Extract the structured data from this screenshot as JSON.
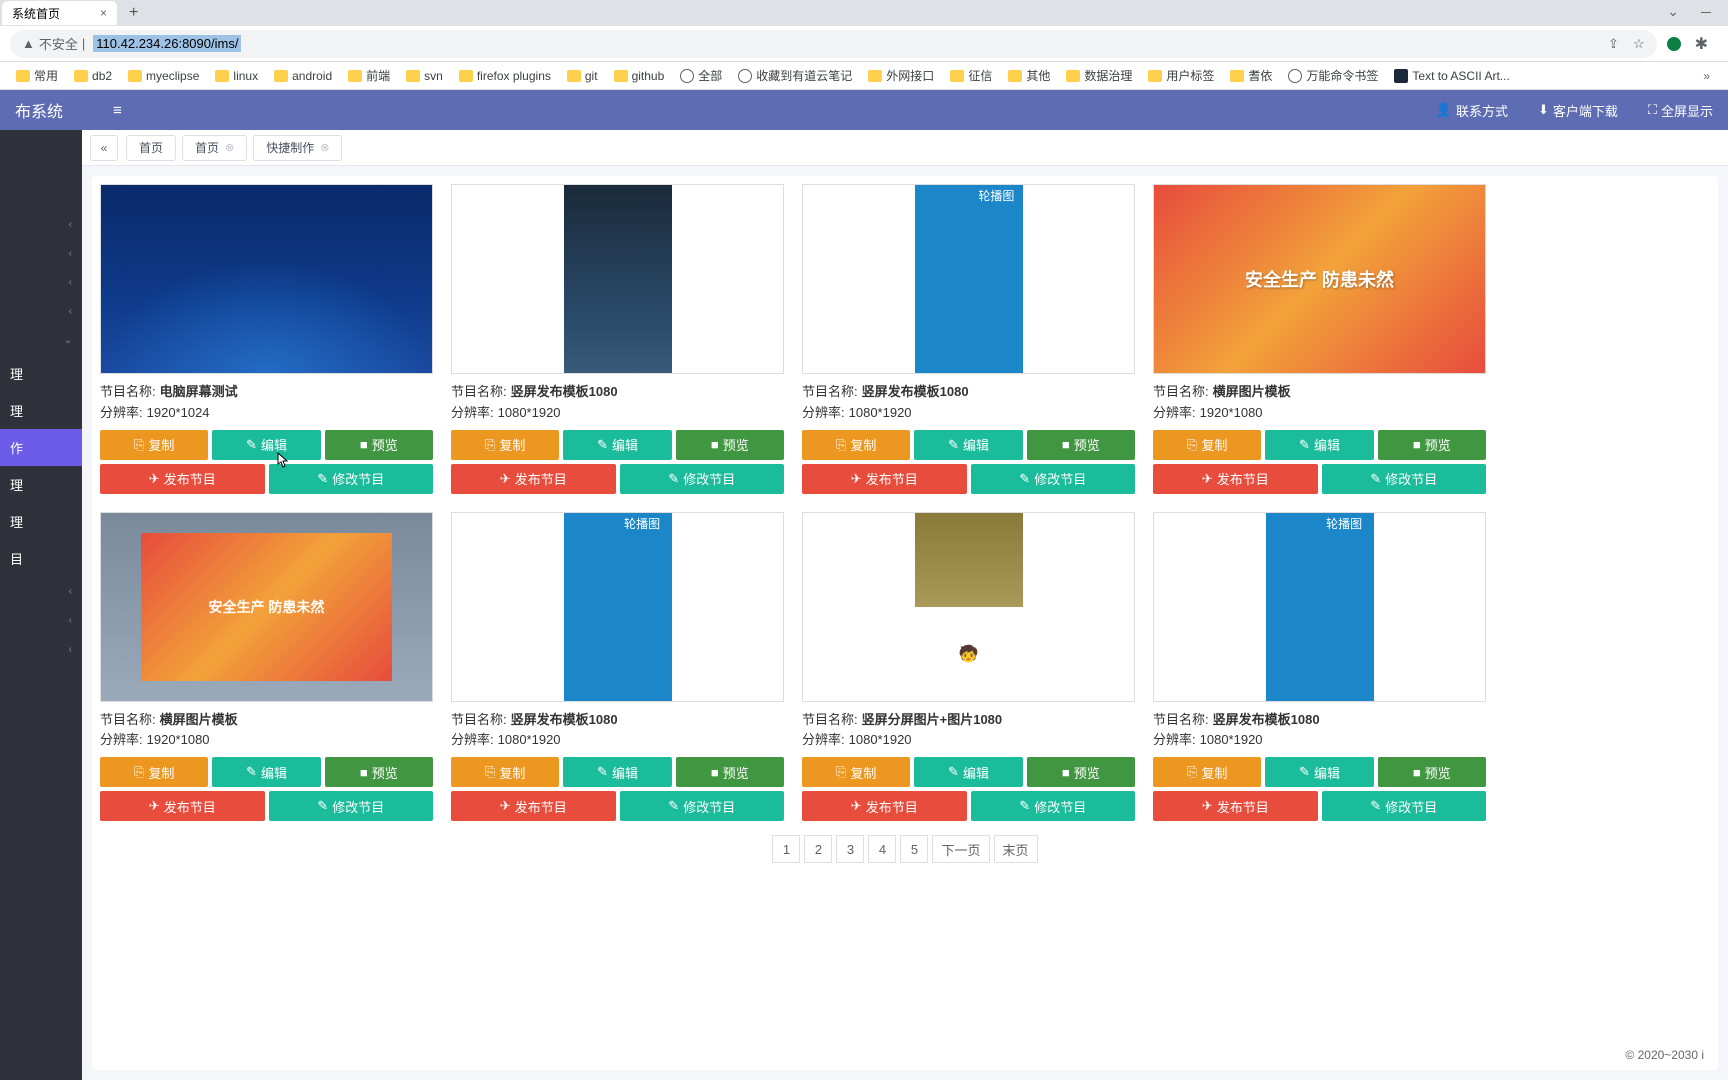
{
  "browser": {
    "tab_title": "系统首页",
    "url_prefix": "不安全",
    "url": "110.42.234.26:8090/ims/",
    "win_minimize": "－",
    "win_chevron": "⌄"
  },
  "bookmarks": [
    "常用",
    "db2",
    "myeclipse",
    "linux",
    "android",
    "前端",
    "svn",
    "firefox plugins",
    "git",
    "github",
    "全部",
    "收藏到有道云笔记",
    "外网接口",
    "征信",
    "其他",
    "数据治理",
    "用户标签",
    "耆依",
    "万能命令书签",
    "Text to ASCII Art..."
  ],
  "header": {
    "app_name": "布系统",
    "contact": "联系方式",
    "client_dl": "客户端下载",
    "fullscreen": "全屏显示"
  },
  "sidebar": {
    "items": [
      "理",
      "理",
      "作",
      "理",
      "理",
      "目"
    ],
    "active_index": 2
  },
  "tabs": {
    "home": "首页",
    "page2": "首页",
    "page3": "快捷制作"
  },
  "labels": {
    "name": "节目名称:",
    "res": "分辨率:",
    "copy": "复制",
    "edit": "编辑",
    "preview": "预览",
    "publish": "发布节目",
    "modify": "修改节目",
    "carousel": "轮播图"
  },
  "cards": [
    {
      "name": "电脑屏幕测试",
      "res": "1920*1024",
      "thumb": "blue"
    },
    {
      "name": "竖屏发布模板1080",
      "res": "1080*1920",
      "thumb": "night"
    },
    {
      "name": "竖屏发布模板1080",
      "res": "1080*1920",
      "thumb": "carousel"
    },
    {
      "name": "横屏图片模板",
      "res": "1920*1080",
      "thumb": "red"
    },
    {
      "name": "横屏图片模板",
      "res": "1920*1080",
      "thumb": "frame"
    },
    {
      "name": "竖屏发布模板1080",
      "res": "1080*1920",
      "thumb": "carousel2"
    },
    {
      "name": "竖屏分屏图片+图片1080",
      "res": "1080*1920",
      "thumb": "mix"
    },
    {
      "name": "竖屏发布模板1080",
      "res": "1080*1920",
      "thumb": "carousel3"
    }
  ],
  "pagination": [
    "1",
    "2",
    "3",
    "4",
    "5",
    "下一页",
    "末页"
  ],
  "footer": "© 2020~2030 i",
  "red_banner": "安全生产 防患未然"
}
